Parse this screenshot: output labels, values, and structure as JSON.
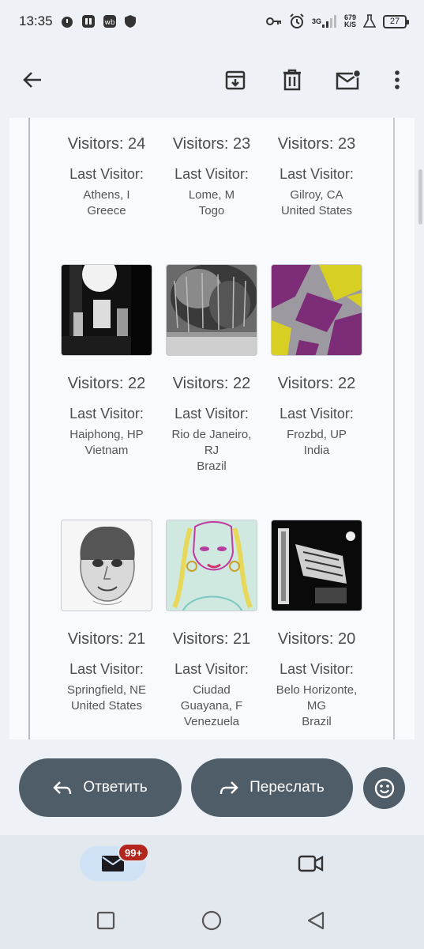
{
  "status_bar": {
    "time": "13:35",
    "network": "3G",
    "speed_value": "679",
    "speed_unit": "K/S",
    "battery": "27"
  },
  "toolbar": {
    "back": "arrow-back-icon",
    "archive": "archive-icon",
    "delete": "delete-icon",
    "mark_unread": "mark-unread-icon",
    "more": "more-vert-icon"
  },
  "stats": [
    {
      "visitors": "Visitors: 24",
      "last": "Last Visitor:",
      "loc1": "Athens, I",
      "loc2": "Greece",
      "loc3": ""
    },
    {
      "visitors": "Visitors: 23",
      "last": "Last Visitor:",
      "loc1": "Lome, M",
      "loc2": "Togo",
      "loc3": ""
    },
    {
      "visitors": "Visitors: 23",
      "last": "Last Visitor:",
      "loc1": "Gilroy, CA",
      "loc2": "United States",
      "loc3": ""
    },
    {
      "visitors": "Visitors: 22",
      "last": "Last Visitor:",
      "loc1": "Haiphong, HP",
      "loc2": "Vietnam",
      "loc3": ""
    },
    {
      "visitors": "Visitors: 22",
      "last": "Last Visitor:",
      "loc1": "Rio de Janeiro,",
      "loc2": "RJ",
      "loc3": "Brazil"
    },
    {
      "visitors": "Visitors: 22",
      "last": "Last Visitor:",
      "loc1": "Frozbd, UP",
      "loc2": "India",
      "loc3": ""
    },
    {
      "visitors": "Visitors: 21",
      "last": "Last Visitor:",
      "loc1": "Springfield, NE",
      "loc2": "United States",
      "loc3": ""
    },
    {
      "visitors": "Visitors: 21",
      "last": "Last Visitor:",
      "loc1": "Ciudad",
      "loc2": "Guayana, F",
      "loc3": "Venezuela"
    },
    {
      "visitors": "Visitors: 20",
      "last": "Last Visitor:",
      "loc1": "Belo Horizonte,",
      "loc2": "MG",
      "loc3": "Brazil"
    }
  ],
  "actions": {
    "reply": "Ответить",
    "forward": "Переслать"
  },
  "bottom_nav": {
    "mail_badge": "99+"
  },
  "colors": {
    "pill": "#4f5d68",
    "badge": "#b3261e",
    "mail_tab": "#cfe2f6"
  }
}
